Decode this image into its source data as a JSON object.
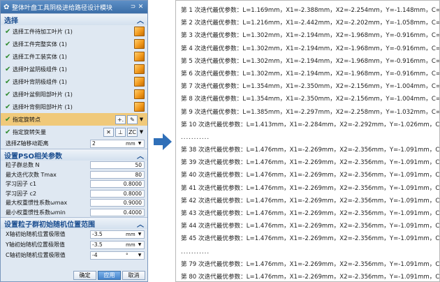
{
  "dialog": {
    "title": "整体叶盘工具阴极进给路径设计模块",
    "sections": {
      "select": "选择",
      "pso": "设置PSO相关参数",
      "range": "设置粒子群初始随机位置范围"
    },
    "select_items": [
      "选择工件待加工叶片 (1)",
      "选择工件完整实体 (1)",
      "选择工件工装实体 (1)",
      "选择叶盆阴极组件 (1)",
      "选择叶背阴极组件 (1)",
      "选择叶盆侧阳部叶片 (1)",
      "选择叶背侧阳部叶片 (1)"
    ],
    "rotation_point": "指定旋转点",
    "rotation_vector": "指定旋转矢量",
    "zc_label": "ZC",
    "z_move": {
      "label": "选择Z轴移动距离",
      "value": "2",
      "unit": "mm"
    },
    "pso_params": [
      {
        "label": "粒子群总数 N",
        "value": "50"
      },
      {
        "label": "最大迭代次数 Tmax",
        "value": "80"
      },
      {
        "label": "学习因子 c1",
        "value": "0.8000"
      },
      {
        "label": "学习因子 c2",
        "value": "0.8000"
      },
      {
        "label": "最大权重惯性系数ωmax",
        "value": "0.9000"
      },
      {
        "label": "最小权重惯性系数ωmin",
        "value": "0.4000"
      }
    ],
    "ranges": [
      {
        "label": "X轴初始随机位置极限值",
        "value": "-3.5",
        "unit": "mm"
      },
      {
        "label": "Y轴初始随机位置极限值",
        "value": "-3.5",
        "unit": "mm"
      },
      {
        "label": "C轴初始随机位置极限值",
        "value": "-4",
        "unit": "°"
      }
    ],
    "buttons": {
      "ok": "确定",
      "apply": "应用",
      "cancel": "取消"
    }
  },
  "results": [
    "第 1 次迭代最优参数：L=1.169mm，X1=-2.388mm，X2=-2.254mm，Y=-1.148mm，C=-3.022°",
    "第 2 次迭代最优参数：L=1.216mm，X1=-2.442mm，X2=-2.202mm，Y=-1.058mm，C=-2.870°",
    "第 3 次迭代最优参数：L=1.302mm，X1=-2.194mm，X2=-1.968mm，Y=-0.916mm，C=-2.380°",
    "第 4 次迭代最优参数：L=1.302mm，X1=-2.194mm，X2=-1.968mm，Y=-0.916mm，C=-2.380°",
    "第 5 次迭代最优参数：L=1.302mm，X1=-2.194mm，X2=-1.968mm，Y=-0.916mm，C=-2.380°",
    "第 6 次迭代最优参数：L=1.302mm，X1=-2.194mm，X2=-1.968mm，Y=-0.916mm，C=-2.380°",
    "第 7 次迭代最优参数：L=1.354mm，X1=-2.350mm，X2=-2.156mm，Y=-1.004mm，C=-2.589°",
    "第 8 次迭代最优参数：L=1.354mm，X1=-2.350mm，X2=-2.156mm，Y=-1.004mm，C=-2.589°",
    "第 9 次迭代最优参数：L=1.385mm，X1=-2.297mm，X2=-2.258mm，Y=-1.032mm，C=-2.697°",
    "第 10 次迭代最优参数：L=1.413mm，X1=-2.284mm，X2=-2.292mm，Y=-1.026mm，C=-2.707°",
    "...........",
    "第 38 次迭代最优参数：L=1.476mm，X1=-2.269mm，X2=-2.356mm，Y=-1.091mm，C=-2.706°",
    "第 39 次迭代最优参数：L=1.476mm，X1=-2.269mm，X2=-2.356mm，Y=-1.091mm，C=-2.706°",
    "第 40 次迭代最优参数：L=1.476mm，X1=-2.269mm，X2=-2.356mm，Y=-1.091mm，C=-2.706°",
    "第 41 次迭代最优参数：L=1.476mm，X1=-2.269mm，X2=-2.356mm，Y=-1.091mm，C=-2.706°",
    "第 42 次迭代最优参数：L=1.476mm，X1=-2.269mm，X2=-2.356mm，Y=-1.091mm，C=-2.706°",
    "第 43 次迭代最优参数：L=1.476mm，X1=-2.269mm，X2=-2.356mm，Y=-1.091mm，C=-2.706°",
    "第 44 次迭代最优参数：L=1.476mm，X1=-2.269mm，X2=-2.356mm，Y=-1.091mm，C=-2.706°",
    "第 45 次迭代最优参数：L=1.476mm，X1=-2.269mm，X2=-2.356mm，Y=-1.091mm，C=-2.706°",
    "...........",
    "第 79 次迭代最优参数：L=1.476mm，X1=-2.269mm，X2=-2.356mm，Y=-1.091mm，C=-2.706°",
    "第 80 次迭代最优参数：L=1.476mm，X1=-2.269mm，X2=-2.356mm，Y=-1.091mm，C=-2.706°"
  ]
}
